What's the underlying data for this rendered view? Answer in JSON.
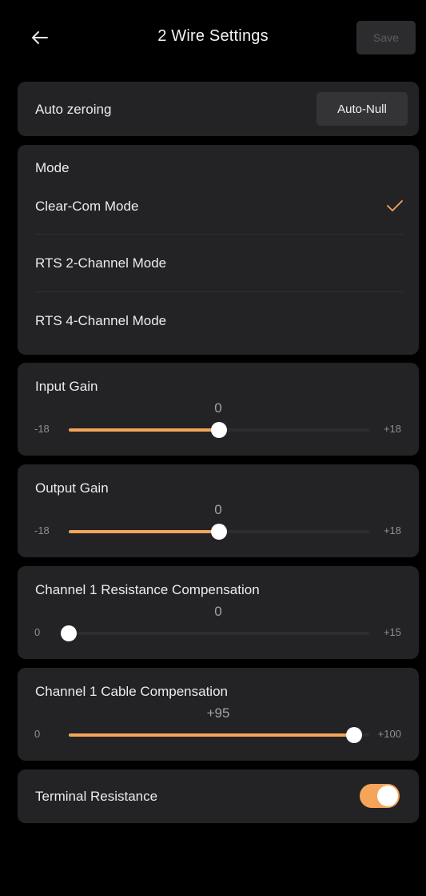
{
  "header": {
    "title": "2 Wire Settings",
    "save_label": "Save"
  },
  "auto_zeroing": {
    "label": "Auto zeroing",
    "button_label": "Auto-Null"
  },
  "mode": {
    "label": "Mode",
    "options": [
      {
        "label": "Clear-Com Mode",
        "selected": true
      },
      {
        "label": "RTS 2-Channel Mode",
        "selected": false
      },
      {
        "label": "RTS 4-Channel Mode",
        "selected": false
      }
    ]
  },
  "sliders": [
    {
      "label": "Input Gain",
      "value_text": "0",
      "min_label": "-18",
      "max_label": "+18",
      "min": -18,
      "max": 18,
      "value": 0
    },
    {
      "label": "Output Gain",
      "value_text": "0",
      "min_label": "-18",
      "max_label": "+18",
      "min": -18,
      "max": 18,
      "value": 0
    },
    {
      "label": "Channel 1 Resistance Compensation",
      "value_text": "0",
      "min_label": "0",
      "max_label": "+15",
      "min": 0,
      "max": 15,
      "value": 0
    },
    {
      "label": "Channel 1 Cable Compensation",
      "value_text": "+95",
      "min_label": "0",
      "max_label": "+100",
      "min": 0,
      "max": 100,
      "value": 95
    }
  ],
  "terminal_resistance": {
    "label": "Terminal Resistance",
    "enabled": true
  },
  "colors": {
    "accent": "#f4a55a",
    "card": "#232325",
    "background": "#000000"
  }
}
